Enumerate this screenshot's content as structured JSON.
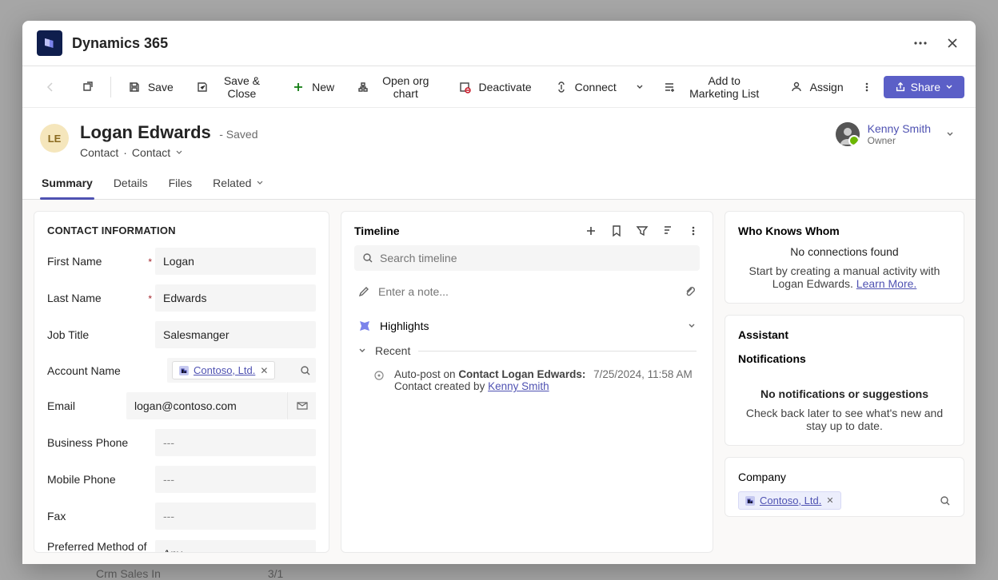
{
  "app": {
    "title": "Dynamics 365"
  },
  "cmd": {
    "save": "Save",
    "saveClose": "Save & Close",
    "new": "New",
    "openOrg": "Open org chart",
    "deactivate": "Deactivate",
    "connect": "Connect",
    "addMktg": "Add to Marketing List",
    "assign": "Assign",
    "share": "Share"
  },
  "record": {
    "initials": "LE",
    "name": "Logan Edwards",
    "savedSuffix": "- Saved",
    "entity1": "Contact",
    "sep": "·",
    "entity2": "Contact"
  },
  "owner": {
    "name": "Kenny Smith",
    "role": "Owner"
  },
  "tabs": {
    "summary": "Summary",
    "details": "Details",
    "files": "Files",
    "related": "Related"
  },
  "contactInfo": {
    "sectionTitle": "CONTACT INFORMATION",
    "fields": {
      "firstName": {
        "label": "First Name",
        "value": "Logan"
      },
      "lastName": {
        "label": "Last Name",
        "value": "Edwards"
      },
      "jobTitle": {
        "label": "Job Title",
        "value": "Salesmanger"
      },
      "accountName": {
        "label": "Account Name",
        "chip": "Contoso, Ltd."
      },
      "email": {
        "label": "Email",
        "value": "logan@contoso.com"
      },
      "businessPhone": {
        "label": "Business Phone",
        "placeholder": "---"
      },
      "mobilePhone": {
        "label": "Mobile Phone",
        "placeholder": "---"
      },
      "fax": {
        "label": "Fax",
        "placeholder": "---"
      },
      "preferredMethod": {
        "label": "Preferred Method of Contact",
        "value": "Any"
      }
    }
  },
  "timeline": {
    "title": "Timeline",
    "searchPlaceholder": "Search timeline",
    "notePlaceholder": "Enter a note...",
    "highlights": "Highlights",
    "recent": "Recent",
    "post": {
      "prefix": "Auto-post on ",
      "subject": "Contact Logan Edwards:",
      "timestamp": "7/25/2024, 11:58 AM",
      "byPrefix": "Contact created by ",
      "byUser": "Kenny Smith"
    }
  },
  "who": {
    "title": "Who Knows Whom",
    "none": "No connections found",
    "hint": "Start by creating a manual activity with Logan Edwards.",
    "learn": "Learn More."
  },
  "assistant": {
    "title": "Assistant"
  },
  "notifications": {
    "title": "Notifications",
    "none": "No notifications or suggestions",
    "hint": "Check back later to see what's new and stay up to date."
  },
  "company": {
    "title": "Company",
    "chip": "Contoso, Ltd."
  },
  "background": {
    "leftnav_item": "Crm Sales In",
    "leftnav_badge": "3/1"
  }
}
